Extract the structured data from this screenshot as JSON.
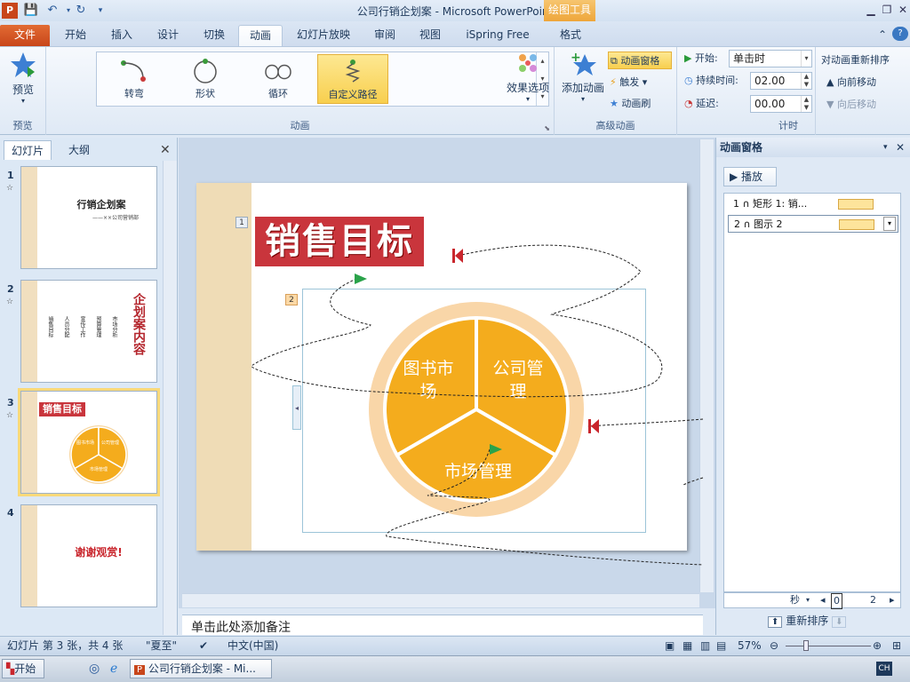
{
  "window": {
    "title": "公司行销企划案 - Microsoft PowerPoint",
    "context_tab": "绘图工具"
  },
  "tabs": [
    "文件",
    "开始",
    "插入",
    "设计",
    "切换",
    "动画",
    "幻灯片放映",
    "审阅",
    "视图",
    "iSpring Free",
    "格式"
  ],
  "ribbon": {
    "preview_label": "预览",
    "preview_group": "预览",
    "gallery": [
      "转弯",
      "形状",
      "循环",
      "自定义路径"
    ],
    "effect_options": "效果选项",
    "anim_group": "动画",
    "add_anim": "添加动画",
    "anim_pane_btn": "动画窗格",
    "trigger": "触发",
    "anim_painter": "动画刷",
    "adv_group": "高级动画",
    "start_label": "开始:",
    "start_value": "单击时",
    "duration_label": "持续时间:",
    "duration_value": "02.00",
    "delay_label": "延迟:",
    "delay_value": "00.00",
    "timing_group": "计时",
    "reorder_title": "对动画重新排序",
    "move_earlier": "向前移动",
    "move_later": "向后移动"
  },
  "left_panel": {
    "tabs": [
      "幻灯片",
      "大纲"
    ],
    "thumbs": [
      {
        "num": "1",
        "title": "行销企划案",
        "sub": "——××公司营销部"
      },
      {
        "num": "2",
        "title": "企划案内容",
        "cols": [
          "销售目标",
          "人员分配",
          "宣传工作",
          "预算管理",
          "市场分析"
        ]
      },
      {
        "num": "3",
        "title": "销售目标",
        "segments": [
          "图书市场",
          "公司管理",
          "市场管理"
        ]
      },
      {
        "num": "4",
        "title": "谢谢观赏!"
      }
    ]
  },
  "slide": {
    "title": "销售目标",
    "tag1": "1",
    "tag2": "2",
    "segments": [
      "图书市场",
      "公司管理",
      "市场管理"
    ]
  },
  "notes": "单击此处添加备注",
  "anim_pane": {
    "title": "动画窗格",
    "play": "播放",
    "items": [
      {
        "label": "1 ∩ 矩形 1: 销..."
      },
      {
        "label": "2 ∩ 图示 2"
      }
    ],
    "sec": "秒",
    "scale_0": "0",
    "scale_2": "2",
    "reorder": "重新排序"
  },
  "status": {
    "slide_info": "幻灯片 第 3 张，共 4 张",
    "theme": "\"夏至\"",
    "lang": "中文(中国)",
    "zoom": "57%"
  },
  "taskbar": {
    "start": "开始",
    "app": "公司行销企划案 - Mi...",
    "ime": "CH"
  }
}
